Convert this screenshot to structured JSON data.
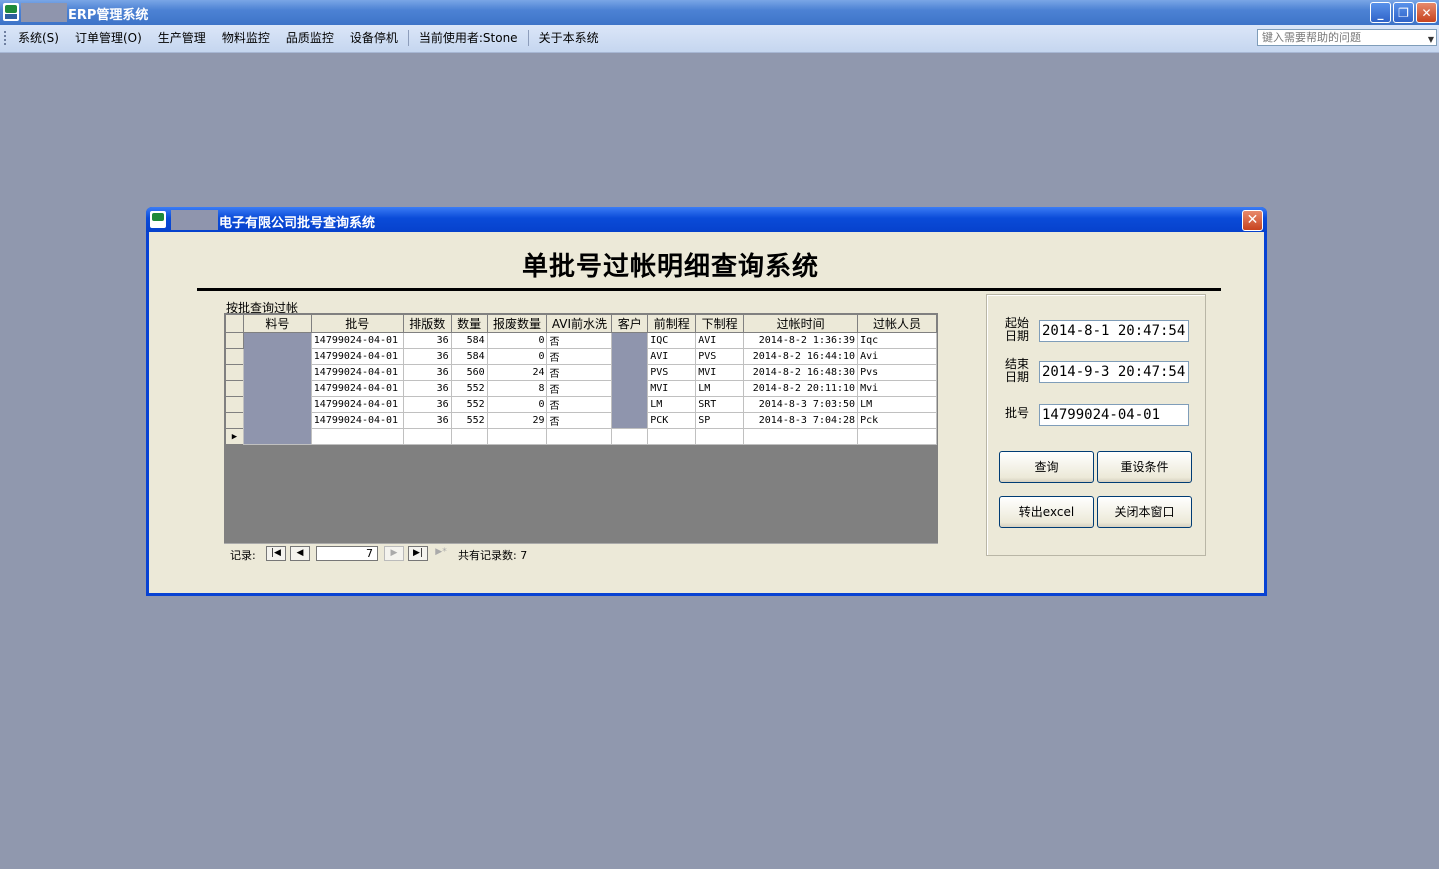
{
  "app": {
    "title": "ERP管理系统"
  },
  "menu": {
    "items": [
      "系统(S)",
      "订单管理(O)",
      "生产管理",
      "物料监控",
      "品质监控",
      "设备停机"
    ],
    "current_user": "当前使用者:Stone",
    "about": "关于本系统",
    "help_placeholder": "键入需要帮助的问题"
  },
  "dialog": {
    "title": "电子有限公司批号查询系统",
    "heading": "单批号过帐明细查询系统",
    "group_label": "按批查询过帐"
  },
  "grid": {
    "columns": [
      "料号",
      "批号",
      "排版数",
      "数量",
      "报废数量",
      "AVI前水洗",
      "客户",
      "前制程",
      "下制程",
      "过帐时间",
      "过帐人员"
    ],
    "rows": [
      {
        "lot": "14799024-04-01",
        "panel": "36",
        "qty": "584",
        "scrap": "0",
        "wash": "否",
        "prev": "IQC",
        "next": "AVI",
        "time": "2014-8-2 1:36:39",
        "op": "Iqc"
      },
      {
        "lot": "14799024-04-01",
        "panel": "36",
        "qty": "584",
        "scrap": "0",
        "wash": "否",
        "prev": "AVI",
        "next": "PVS",
        "time": "2014-8-2 16:44:10",
        "op": "Avi"
      },
      {
        "lot": "14799024-04-01",
        "panel": "36",
        "qty": "560",
        "scrap": "24",
        "wash": "否",
        "prev": "PVS",
        "next": "MVI",
        "time": "2014-8-2 16:48:30",
        "op": "Pvs"
      },
      {
        "lot": "14799024-04-01",
        "panel": "36",
        "qty": "552",
        "scrap": "8",
        "wash": "否",
        "prev": "MVI",
        "next": "LM",
        "time": "2014-8-2 20:11:10",
        "op": "Mvi"
      },
      {
        "lot": "14799024-04-01",
        "panel": "36",
        "qty": "552",
        "scrap": "0",
        "wash": "否",
        "prev": "LM",
        "next": "SRT",
        "time": "2014-8-3 7:03:50",
        "op": "LM"
      },
      {
        "lot": "14799024-04-01",
        "panel": "36",
        "qty": "552",
        "scrap": "29",
        "wash": "否",
        "prev": "PCK",
        "next": "SP",
        "time": "2014-8-3 7:04:28",
        "op": "Pck"
      }
    ],
    "nav_label": "记录:",
    "record_no": "7",
    "total_label": "共有记录数: 7"
  },
  "form": {
    "start_label": "起始日期",
    "start_value": "2014-8-1 20:47:54",
    "end_label": "结束日期",
    "end_value": "2014-9-3 20:47:54",
    "lot_label": "批号",
    "lot_value": "14799024-04-01",
    "query_btn": "查询",
    "reset_btn": "重设条件",
    "export_btn": "转出excel",
    "close_btn": "关闭本窗口"
  }
}
